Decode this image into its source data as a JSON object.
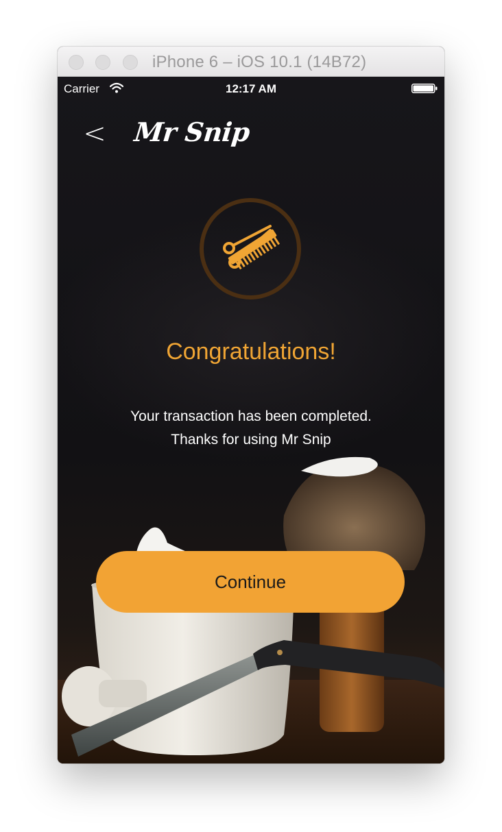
{
  "window": {
    "title": "iPhone 6 – iOS 10.1 (14B72)",
    "traffic_lights": [
      "close",
      "minimize",
      "zoom"
    ]
  },
  "status_bar": {
    "carrier": "Carrier",
    "time": "12:17 AM",
    "icons": [
      "wifi-icon",
      "battery-icon"
    ]
  },
  "nav": {
    "back_label": "<",
    "logo_text": "Mr Snip"
  },
  "content": {
    "badge_icon": "scissors-comb-icon",
    "title": "Congratulations!",
    "message_line1": "Your transaction has been completed.",
    "message_line2": "Thanks for using Mr Snip"
  },
  "actions": {
    "continue_label": "Continue"
  },
  "colors": {
    "accent": "#f2a334",
    "title": "#f0a534",
    "background": "#151416",
    "text": "#ffffff"
  }
}
